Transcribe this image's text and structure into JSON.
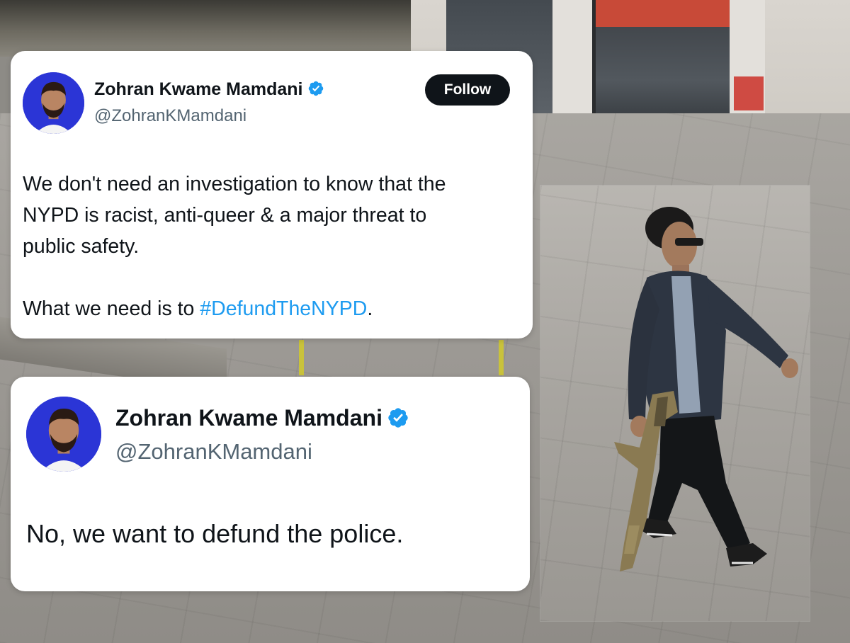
{
  "tweets": [
    {
      "author_name": "Zohran Kwame Mamdani",
      "handle": "@ZohranKMamdani",
      "follow_label": "Follow",
      "text_line1": "We don't need an investigation to know that the\nNYPD is racist, anti-queer & a major threat to\npublic safety.\n\nWhat we need is to ",
      "hashtag": "#DefundTheNYPD",
      "text_end": "."
    },
    {
      "author_name": "Zohran Kwame Mamdani",
      "handle": "@ZohranKMamdani",
      "text": "No, we want to defund the police."
    }
  ],
  "icons": {
    "verified": "verified-badge-icon",
    "avatar": "profile-avatar"
  },
  "colors": {
    "accent": "#1d9bf0",
    "avatar_bg": "#2b35d6",
    "follow_bg": "#0f1419",
    "text": "#0f1419",
    "muted": "#536471"
  }
}
